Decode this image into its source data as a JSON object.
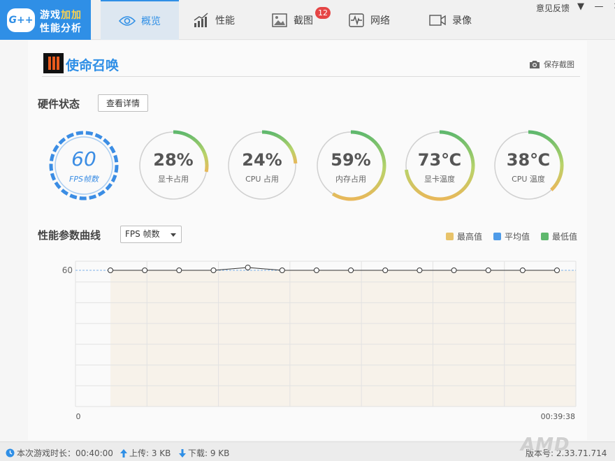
{
  "app": {
    "logo_badge": "G++",
    "logo_line1_a": "游戏",
    "logo_line1_b": "加加",
    "logo_line2": "性能分析",
    "brand_color": "#2f8fe6"
  },
  "tabs": [
    {
      "label": "概览",
      "icon": "eye-icon"
    },
    {
      "label": "性能",
      "icon": "bar-chart-icon"
    },
    {
      "label": "截图",
      "icon": "image-icon",
      "badge": "12"
    },
    {
      "label": "网络",
      "icon": "pulse-icon"
    },
    {
      "label": "录像",
      "icon": "video-icon"
    }
  ],
  "window": {
    "feedback": "意见反馈",
    "menu": "▼",
    "minimize": "—",
    "close": "✕"
  },
  "game": {
    "title": "使命召唤",
    "save_screenshot": "保存截图"
  },
  "hardware": {
    "label": "硬件状态",
    "detail_button": "查看详情",
    "gauges": [
      {
        "value": "60",
        "label": "FPS帧数"
      },
      {
        "value": "28%",
        "label": "显卡占用",
        "fraction": 0.28
      },
      {
        "value": "24%",
        "label": "CPU 占用",
        "fraction": 0.24
      },
      {
        "value": "59%",
        "label": "内存占用",
        "fraction": 0.59
      },
      {
        "value": "73℃",
        "label": "显卡温度",
        "fraction": 0.73
      },
      {
        "value": "38℃",
        "label": "CPU 温度",
        "fraction": 0.38
      }
    ]
  },
  "curve": {
    "label": "性能参数曲线",
    "select_value": "FPS 帧数",
    "legend": [
      {
        "label": "最高值",
        "color": "#e8c36a"
      },
      {
        "label": "平均值",
        "color": "#4e9be8"
      },
      {
        "label": "最低值",
        "color": "#5fb86d"
      }
    ]
  },
  "chart_data": {
    "type": "line",
    "x_start_label": "0",
    "x_end_label": "00:39:38",
    "y_tick": "60",
    "y_tick_value": 60,
    "points": [
      60,
      60,
      60,
      60,
      61,
      60,
      60,
      60,
      60,
      60,
      60,
      60,
      60,
      60
    ]
  },
  "status": {
    "play_time": "本次游戏时长：00:40:00",
    "upload": "上传: 3 KB",
    "download": "下载: 9 KB",
    "version": "版本号: 2.33.71.714"
  },
  "watermark": "AMD"
}
